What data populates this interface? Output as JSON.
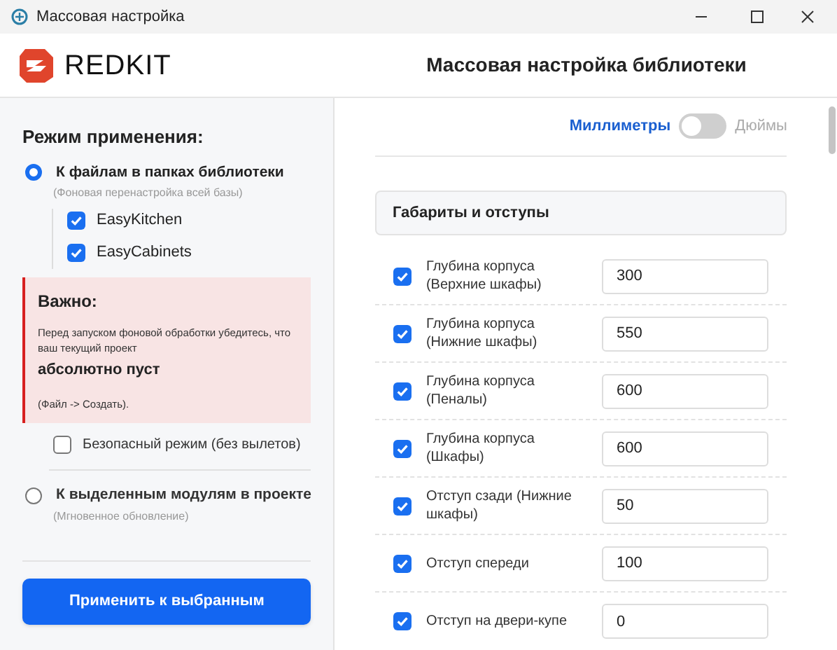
{
  "window": {
    "title": "Массовая настройка"
  },
  "header": {
    "logo_text": "REDKIT",
    "title": "Массовая настройка библиотеки"
  },
  "mode": {
    "heading": "Режим применения:",
    "options": [
      {
        "label": "К файлам в папках библиотеки",
        "hint": "(Фоновая перенастройка всей базы)",
        "selected": true,
        "libraries": [
          {
            "label": "EasyKitchen",
            "checked": true
          },
          {
            "label": "EasyCabinets",
            "checked": true
          }
        ],
        "warning": {
          "title": "Важно:",
          "text": "Перед запуском фоновой обработки убедитесь, что ваш текущий проект",
          "emphasis": "абсолютно пуст",
          "note": "(Файл -> Создать)."
        },
        "safe_mode": {
          "label": "Безопасный режим (без вылетов)",
          "checked": false
        }
      },
      {
        "label": "К выделенным модулям в проекте",
        "hint": "(Мгновенное обновление)",
        "selected": false
      }
    ]
  },
  "apply_button": "Применить к выбранным",
  "units": {
    "left_label": "Миллиметры",
    "right_label": "Дюймы",
    "on": false
  },
  "section": {
    "title": "Габариты и отступы",
    "rows": [
      {
        "label": "Глубина корпуса (Верхние шкафы)",
        "checked": true,
        "value": "300"
      },
      {
        "label": "Глубина корпуса (Нижние шкафы)",
        "checked": true,
        "value": "550"
      },
      {
        "label": "Глубина корпуса (Пеналы)",
        "checked": true,
        "value": "600"
      },
      {
        "label": "Глубина корпуса (Шкафы)",
        "checked": true,
        "value": "600"
      },
      {
        "label": "Отступ сзади (Нижние шкафы)",
        "checked": true,
        "value": "50"
      },
      {
        "label": "Отступ спереди",
        "checked": true,
        "value": "100"
      },
      {
        "label": "Отступ на двери-купе",
        "checked": true,
        "value": "0"
      }
    ]
  }
}
